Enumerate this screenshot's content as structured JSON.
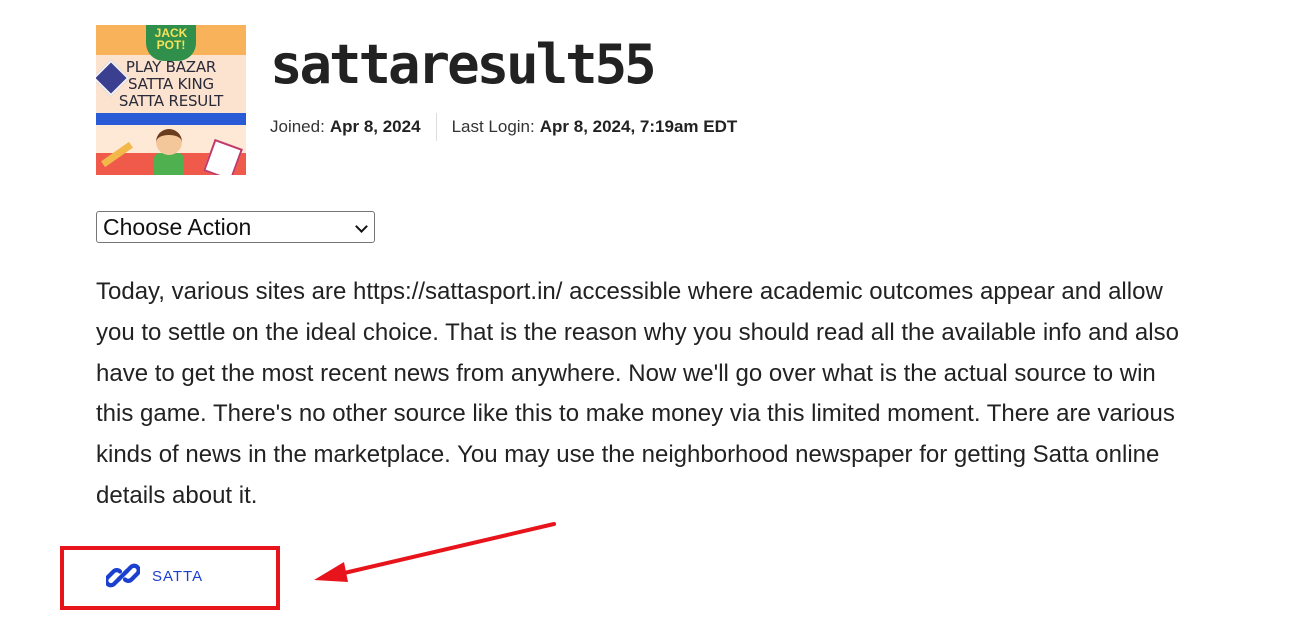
{
  "profile": {
    "avatar_text": {
      "badge": "JACK POT!",
      "line1": "PLAY BAZAR",
      "line2": "SATTA KING",
      "line3": "SATTA RESULT"
    },
    "username": "sattaresult55",
    "joined_label": "Joined:",
    "joined_value": "Apr 8, 2024",
    "last_login_label": "Last Login:",
    "last_login_value": "Apr 8, 2024, 7:19am EDT"
  },
  "actions": {
    "selected": "Choose Action"
  },
  "bio": "Today, various sites are https://sattasport.in/ accessible where academic outcomes appear and allow you to settle on the ideal choice. That is the reason why you should read all the available info and also have to get the most recent news from anywhere. Now we'll go over what is the actual source to win this game. There's no other source like this to make money via this limited moment. There are various kinds of news in the marketplace. You may use the neighborhood newspaper for getting Satta online details about it.",
  "website": {
    "label": "SATTA",
    "icon": "link-icon"
  },
  "colors": {
    "link": "#1b3fcf",
    "annotation": "#e8141c",
    "text": "#222222"
  }
}
